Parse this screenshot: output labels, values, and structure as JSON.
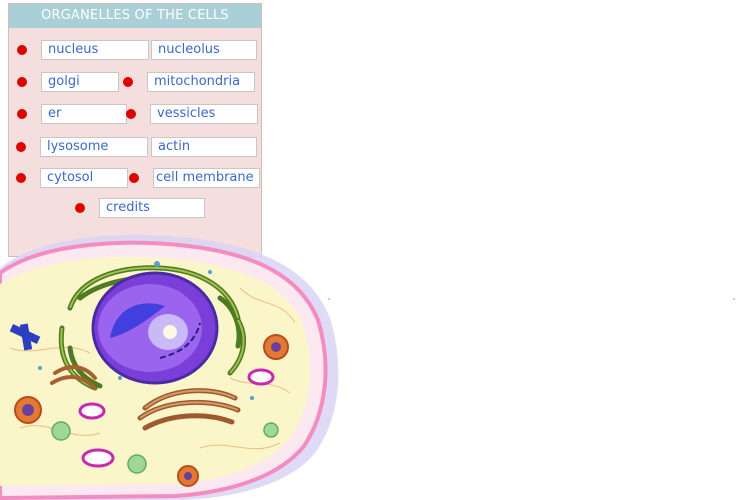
{
  "panel": {
    "title": "ORGANELLES OF THE CELLS",
    "items": [
      {
        "label": "nucleus"
      },
      {
        "label": "nucleolus"
      },
      {
        "label": "golgi"
      },
      {
        "label": "mitochondria"
      },
      {
        "label": "er"
      },
      {
        "label": "vessicles"
      },
      {
        "label": "lysosome"
      },
      {
        "label": "actin"
      },
      {
        "label": "cytosol"
      },
      {
        "label": "cell membrane"
      },
      {
        "label": "credits"
      }
    ]
  },
  "colors": {
    "panel_bg": "#f4dede",
    "title_bg": "#a9cfd7",
    "label_text": "#3b68c9",
    "marker_dot": "#e00000"
  }
}
